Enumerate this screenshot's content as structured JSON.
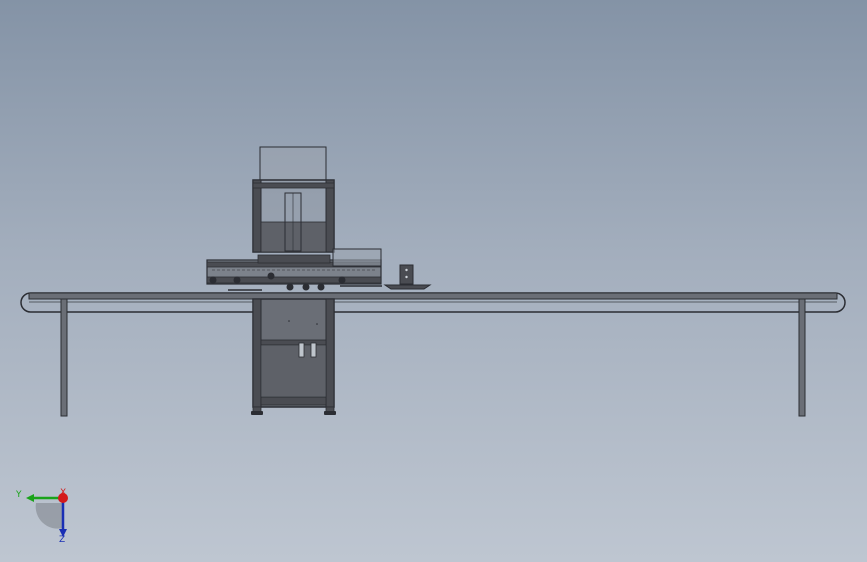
{
  "triad": {
    "y_label": "Y",
    "x_label": "X",
    "z_label": "Z",
    "y_color": "#1aa31a",
    "x_color": "#d41a1a",
    "z_color": "#1a2fb5"
  },
  "colors": {
    "background_top": "#8493a6",
    "background_bottom": "#bec6d1",
    "line": "#2b2d33",
    "dark_fill": "#4a4c52",
    "mid_fill": "#5e6168",
    "frame_fill": "#6a6e76"
  }
}
